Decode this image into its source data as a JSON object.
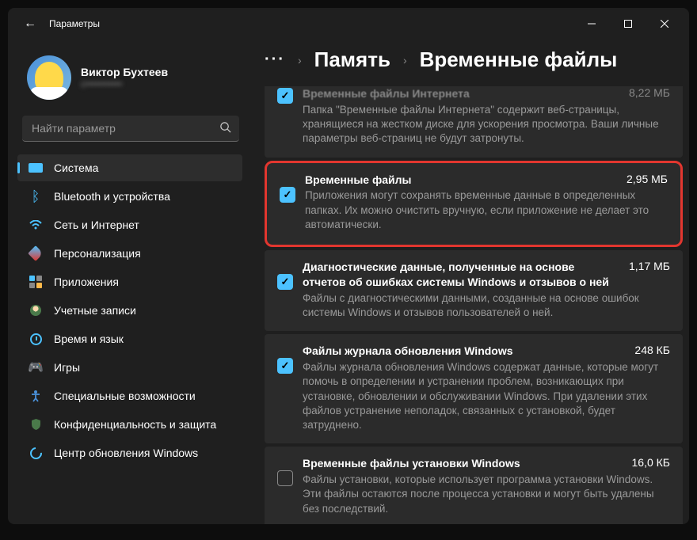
{
  "window": {
    "title": "Параметры"
  },
  "profile": {
    "name": "Виктор Бухтеев",
    "email": "c•••••••••••"
  },
  "search": {
    "placeholder": "Найти параметр"
  },
  "nav": {
    "items": [
      {
        "label": "Система",
        "active": true
      },
      {
        "label": "Bluetooth и устройства"
      },
      {
        "label": "Сеть и Интернет"
      },
      {
        "label": "Персонализация"
      },
      {
        "label": "Приложения"
      },
      {
        "label": "Учетные записи"
      },
      {
        "label": "Время и язык"
      },
      {
        "label": "Игры"
      },
      {
        "label": "Специальные возможности"
      },
      {
        "label": "Конфиденциальность и защита"
      },
      {
        "label": "Центр обновления Windows"
      }
    ]
  },
  "breadcrumb": {
    "parent": "Память",
    "current": "Временные файлы"
  },
  "items": [
    {
      "title": "Временные файлы Интернета",
      "size": "8,22 МБ",
      "desc": "Папка \"Временные файлы Интернета\" содержит веб-страницы, хранящиеся на жестком диске для ускорения просмотра. Ваши личные параметры веб-страниц не будут затронуты.",
      "checked": true
    },
    {
      "title": "Временные файлы",
      "size": "2,95 МБ",
      "desc": "Приложения могут сохранять временные данные в определенных папках. Их можно очистить вручную, если приложение не делает это автоматически.",
      "checked": true,
      "highlighted": true
    },
    {
      "title": "Диагностические данные, полученные на основе отчетов об ошибках системы Windows и отзывов о ней",
      "size": "1,17 МБ",
      "desc": "Файлы с диагностическими данными, созданные на основе ошибок системы Windows и отзывов пользователей о ней.",
      "checked": true
    },
    {
      "title": "Файлы журнала обновления Windows",
      "size": "248 КБ",
      "desc": "Файлы журнала обновления Windows содержат данные, которые могут помочь в определении и устранении проблем, возникающих при установке, обновлении и обслуживании Windows. При удалении этих файлов устранение неполадок, связанных с установкой, будет затруднено.",
      "checked": true
    },
    {
      "title": "Временные файлы установки Windows",
      "size": "16,0 КБ",
      "desc": "Файлы установки, которые использует программа установки Windows.  Эти файлы остаются после процесса установки и могут быть удалены без последствий.",
      "checked": false
    }
  ]
}
